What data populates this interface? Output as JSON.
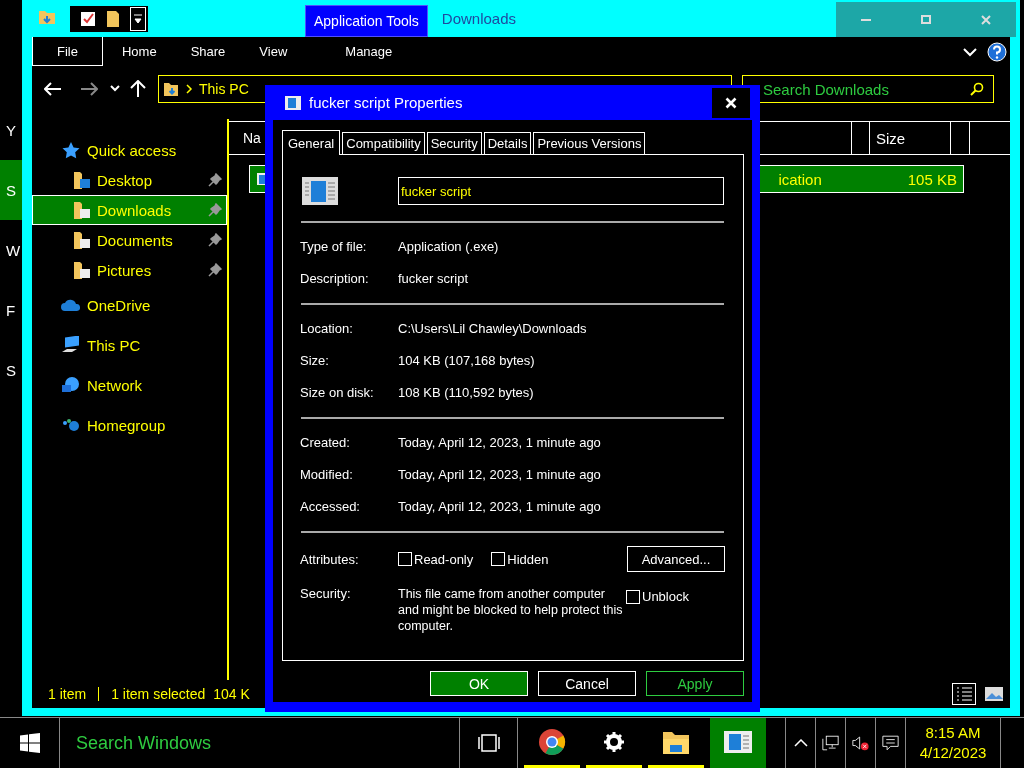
{
  "desktop_fragments": [
    {
      "text": "Y",
      "selected": false
    },
    {
      "text": "S",
      "selected": true
    },
    {
      "text": "W",
      "selected": false
    },
    {
      "text": "F",
      "selected": false
    },
    {
      "text": "S",
      "selected": false
    }
  ],
  "explorer": {
    "context_tab": "Application Tools",
    "title": "Downloads",
    "ribbon_tabs": [
      {
        "label": "File",
        "selected": true
      },
      {
        "label": "Home",
        "selected": false
      },
      {
        "label": "Share",
        "selected": false
      },
      {
        "label": "View",
        "selected": false
      },
      {
        "label": "Manage",
        "selected": false
      }
    ],
    "address": {
      "crumbs": [
        "This PC"
      ]
    },
    "search": {
      "placeholder": "Search Downloads"
    },
    "nav": [
      {
        "label": "Quick access",
        "selected": false,
        "children": [
          {
            "label": "Desktop",
            "pinned": true,
            "selected": false
          },
          {
            "label": "Downloads",
            "pinned": true,
            "selected": true
          },
          {
            "label": "Documents",
            "pinned": true,
            "selected": false
          },
          {
            "label": "Pictures",
            "pinned": true,
            "selected": false
          }
        ]
      },
      {
        "label": "OneDrive",
        "selected": false
      },
      {
        "label": "This PC",
        "selected": false
      },
      {
        "label": "Network",
        "selected": false
      },
      {
        "label": "Homegroup",
        "selected": false
      }
    ],
    "columns": {
      "name": "Na",
      "size": "Size"
    },
    "files": [
      {
        "type": "ication",
        "size": "105 KB",
        "selected": true
      }
    ],
    "status": {
      "count": "1 item",
      "selection": "1 item selected",
      "size": "104 K"
    }
  },
  "dialog": {
    "title": "fucker script Properties",
    "tabs": [
      {
        "label": "General",
        "selected": true
      },
      {
        "label": "Compatibility",
        "selected": false
      },
      {
        "label": "Security",
        "selected": false
      },
      {
        "label": "Details",
        "selected": false
      },
      {
        "label": "Previous Versions",
        "selected": false
      }
    ],
    "name": "fucker script",
    "sections": [
      [
        {
          "label": "Type of file:",
          "value": "Application (.exe)"
        },
        {
          "label": "Description:",
          "value": "fucker script"
        }
      ],
      [
        {
          "label": "Location:",
          "value": "C:\\Users\\Lil Chawley\\Downloads"
        },
        {
          "label": "Size:",
          "value": "104 KB (107,168 bytes)"
        },
        {
          "label": "Size on disk:",
          "value": "108 KB (110,592 bytes)"
        }
      ],
      [
        {
          "label": "Created:",
          "value": "Today, April 12, 2023, 1 minute ago"
        },
        {
          "label": "Modified:",
          "value": "Today, April 12, 2023, 1 minute ago"
        },
        {
          "label": "Accessed:",
          "value": "Today, April 12, 2023, 1 minute ago"
        }
      ]
    ],
    "attributes": {
      "label": "Attributes:",
      "checks": [
        {
          "label": "Read-only",
          "checked": false
        },
        {
          "label": "Hidden",
          "checked": false
        }
      ],
      "button": "Advanced..."
    },
    "security": {
      "label": "Security:",
      "text": "This file came from another computer and might be blocked to help protect this computer.",
      "unblock": {
        "label": "Unblock",
        "checked": false
      }
    },
    "buttons": [
      {
        "label": "OK",
        "kind": "default"
      },
      {
        "label": "Cancel",
        "kind": "plain"
      },
      {
        "label": "Apply",
        "kind": "apply"
      }
    ]
  },
  "taskbar": {
    "search": {
      "placeholder": "Search Windows"
    },
    "apps": [
      {
        "running": true,
        "selected": false
      },
      {
        "running": true,
        "selected": false
      },
      {
        "running": true,
        "selected": false
      },
      {
        "running": false,
        "selected": true
      }
    ],
    "time": "8:15 AM",
    "date": "4/12/2023"
  }
}
